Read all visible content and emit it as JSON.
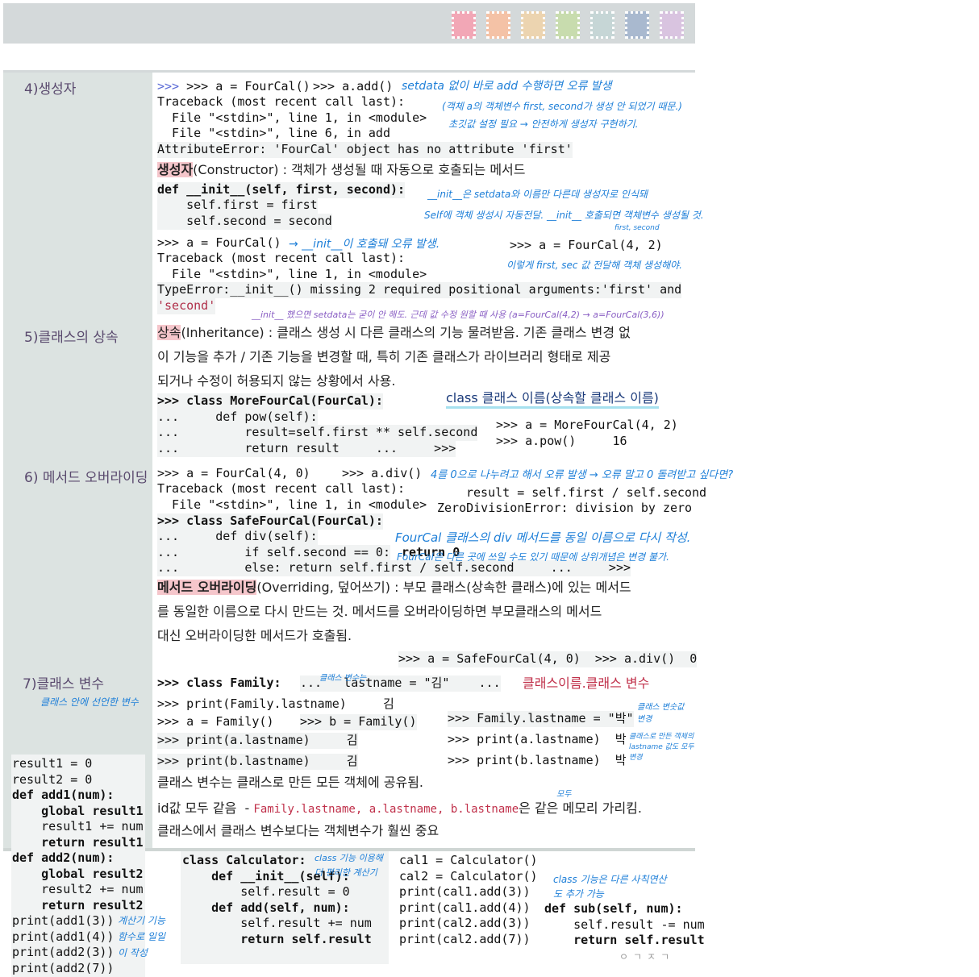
{
  "swatch_colors": [
    "#f2a7b6",
    "#f4c2a6",
    "#ecd4b0",
    "#c8dcae",
    "#c6d6d6",
    "#a9b9cf",
    "#d9c4e0"
  ],
  "sections": {
    "s4": "4)생성자",
    "s5": "5)클래스의 상속",
    "s6": "6) 메서드 오버라이딩",
    "s7": "7)클래스 변수",
    "s7_sub": "클래스 안에 선언한 변수"
  },
  "block1": {
    "l1a": ">>> a = FourCal()",
    "l1b": ">>> a.add()",
    "note1": "setdata 없이 바로 add 수행하면 오류 발생",
    "note2": "(객체 a의 객체변수 first, second가 생성 안 되었기 때문.)",
    "note3": "초깃값 설정 필요 → 안전하게 생성자 구현하기.",
    "l2": "Traceback (most recent call last):",
    "l3": "  File \"<stdin>\", line 1, in <module>",
    "l4": "  File \"<stdin>\", line 6, in add",
    "l5": "AttributeError: 'FourCal' object has no attribute 'first'"
  },
  "ctor": {
    "term": "생성자",
    "desc": "(Constructor) : 객체가 생성될 때 자동으로 호출되는 메서드"
  },
  "block2": {
    "l1": "def __init__(self, first, second):",
    "l2": "    self.first = first",
    "l3": "    self.second = second",
    "note1": "__init__은 setdata와 이름만 다른데 생성자로 인식돼",
    "note2": "Self에 객체 생성시 자동전달. __init__ 호출되면 객체변수 생성될 것.",
    "note3": "first, second"
  },
  "block3": {
    "l1": ">>> a = FourCal()",
    "note1": "→ __init__이 호출돼 오류 발생.",
    "right1": ">>> a = FourCal(4, 2)",
    "note2": "이렇게 first, sec 값 전달해 객체 생성해야.",
    "l2": "Traceback (most recent call last):",
    "l3": "  File \"<stdin>\", line 1, in <module>",
    "l4": "TypeError:__init__() missing 2 required positional arguments:'first' and",
    "l5": "'second'",
    "note3": "__init__ 했으면 setdata는 굳이 안 해도. 근데 값 수정 원할 때 사용 (a=FourCal(4,2) → a=FourCal(3,6))"
  },
  "inherit": {
    "term": "상속",
    "line1": "(Inheritance) : 클래스 생성 시 다른 클래스의 기능 물려받음. 기존 클래스 변경 없",
    "line2": "이 기능을 추가 / 기존 기능을 변경할 때, 특히 기존 클래스가 라이브러리 형태로 제공",
    "line3": "되거나 수정이 허용되지 않는 상황에서 사용.",
    "syntax": "class 클래스 이름(상속할 클래스 이름)"
  },
  "block4": {
    "l1": ">>> class MoreFourCal(FourCal):",
    "l2": "...     def pow(self):",
    "l3": "...         result=self.first ** self.second",
    "l4": "...         return result     ...     >>>",
    "r1": ">>> a = MoreFourCal(4, 2)",
    "r2": ">>> a.pow()     16"
  },
  "block5": {
    "l1a": ">>> a = FourCal(4, 0)",
    "l1b": ">>> a.div()",
    "note1": "4를 0으로 나누려고 해서 오류 발생 → 오류 말고 0 돌려받고 싶다면?",
    "r1": "result = self.first / self.second",
    "l2": "Traceback (most recent call last):",
    "l3": "  File \"<stdin>\", line 1, in <module>",
    "r2": "ZeroDivisionError: division by zero",
    "l4": ">>> class SafeFourCal(FourCal):",
    "l5": "...     def div(self):",
    "l6": "...         if self.second == 0:",
    "l6b": "return 0",
    "l7": "...         else: return self.first / self.second     ...     >>>",
    "note2": "FourCal 클래스의 div 메서드를 동일 이름으로 다시 작성.",
    "note3": "FourCal은 다른 곳에 쓰일 수도 있기 때문에 상위개념은 변경 불가."
  },
  "override": {
    "term": "메서드 오버라이딩",
    "line1": "(Overriding, 덮어쓰기) : 부모 클래스(상속한 클래스)에 있는 메서드",
    "line2": "를 동일한 이름으로 다시 만드는 것. 메서드를 오버라이딩하면 부모클래스의 메서드",
    "line3": "대신 오버라이딩한 메서드가 호출됨.",
    "demo": ">>> a = SafeFourCal(4, 0)  >>> a.div()  0"
  },
  "block6": {
    "l1": ">>> class Family:",
    "l1b": "...   lastname = \"김\"    ...",
    "note1": "클래스 변수는",
    "right_label": "클래스이름.클래스 변수",
    "l2": ">>> print(Family.lastname)     김",
    "l3a": ">>> a = Family()",
    "l3b": ">>> b = Family()",
    "l4": ">>> print(a.lastname)     김",
    "l5": ">>> print(b.lastname)     김",
    "r1": ">>> Family.lastname = \"박\"",
    "r2": ">>> print(a.lastname)  박",
    "r3": ">>> print(b.lastname)  박",
    "note2": "클래스 변숫값 변경",
    "note3": "클래스로 만든 객체의 lastname 값도 모두 변경"
  },
  "classvar": {
    "line1": "클래스 변수는 클래스로 만든 모든 객체에 공유됨.",
    "line2a": "id값 모두 같음  - ",
    "line2b": "Family.lastname, a.lastname, b.lastname",
    "line2c": "은 같은 메모리 가리킴.",
    "line3": "클래스에서 클래스 변수보다는 객체변수가 훨씬 중요",
    "note_mo": "모두"
  },
  "bottom": {
    "left": [
      "result1 = 0",
      "result2 = 0",
      "def add1(num):",
      "    global result1",
      "    result1 += num",
      "    return result1",
      "def add2(num):",
      "    global result2",
      "    result2 += num",
      "    return result2",
      "print(add1(3))",
      "print(add1(4))",
      "print(add2(3))",
      "print(add2(7))"
    ],
    "left_note": "계산기 기능 함수로 일일이 작성",
    "calc": [
      "class Calculator:",
      "    def __init__(self):",
      "        self.result = 0",
      "    def add(self, num):",
      "        self.result += num",
      "        return self.result"
    ],
    "calc_note": "class 기능 이용해 더 편리한 계산기",
    "calls": [
      "cal1 = Calculator()",
      "cal2 = Calculator()",
      "print(cal1.add(3))",
      "print(cal1.add(4))",
      "print(cal2.add(3))",
      "print(cal2.add(7))"
    ],
    "sub_note": "class 기능은 다른 사칙연산도 추가 가능",
    "sub": [
      "def sub(self, num):",
      "    self.result -= num",
      "    return self.result"
    ],
    "sig": "ㅇㄱㅈㄱ"
  }
}
